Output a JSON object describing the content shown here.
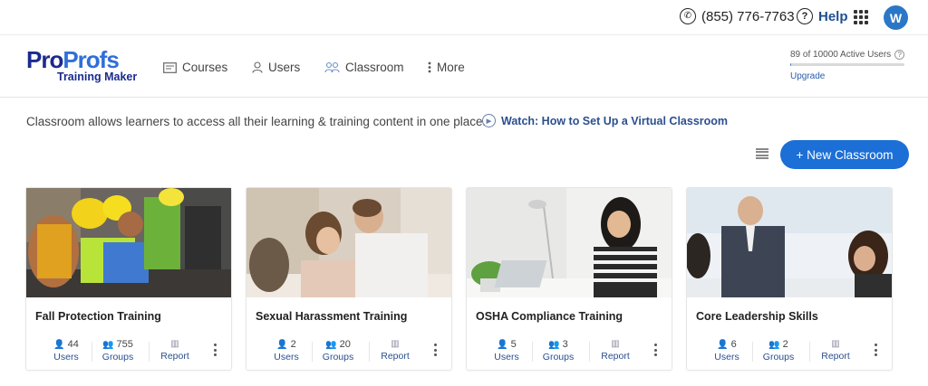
{
  "topbar": {
    "phone": "(855) 776-7763",
    "help": "Help",
    "avatar_initial": "W"
  },
  "brand": {
    "logo_pro": "Pro",
    "logo_profs": "Profs",
    "logo_sub": "Training Maker",
    "colors": {
      "primary": "#1b2a8f",
      "accent": "#2f6fd8",
      "button": "#1b6fd6"
    }
  },
  "nav": {
    "items": [
      {
        "label": "Courses",
        "icon": "courses-icon"
      },
      {
        "label": "Users",
        "icon": "users-icon"
      },
      {
        "label": "Classroom",
        "icon": "classroom-icon"
      },
      {
        "label": "More",
        "icon": "more-icon"
      }
    ]
  },
  "usage": {
    "text": "89 of 10000 Active Users",
    "fraction": 0.0089,
    "upgrade": "Upgrade"
  },
  "intro": {
    "text": "Classroom allows learners to access all their learning & training content in one place.",
    "watch": "Watch: How to Set Up a Virtual Classroom"
  },
  "toolbar": {
    "new_classroom": "+ New Classroom"
  },
  "stat_labels": {
    "users": "Users",
    "groups": "Groups",
    "report": "Report"
  },
  "classrooms": [
    {
      "title": "Fall Protection Training",
      "users": "44",
      "groups": "755"
    },
    {
      "title": "Sexual Harassment Training",
      "users": "2",
      "groups": "20"
    },
    {
      "title": "OSHA Compliance Training",
      "users": "5",
      "groups": "3"
    },
    {
      "title": "Core Leadership Skills",
      "users": "6",
      "groups": "2"
    }
  ]
}
